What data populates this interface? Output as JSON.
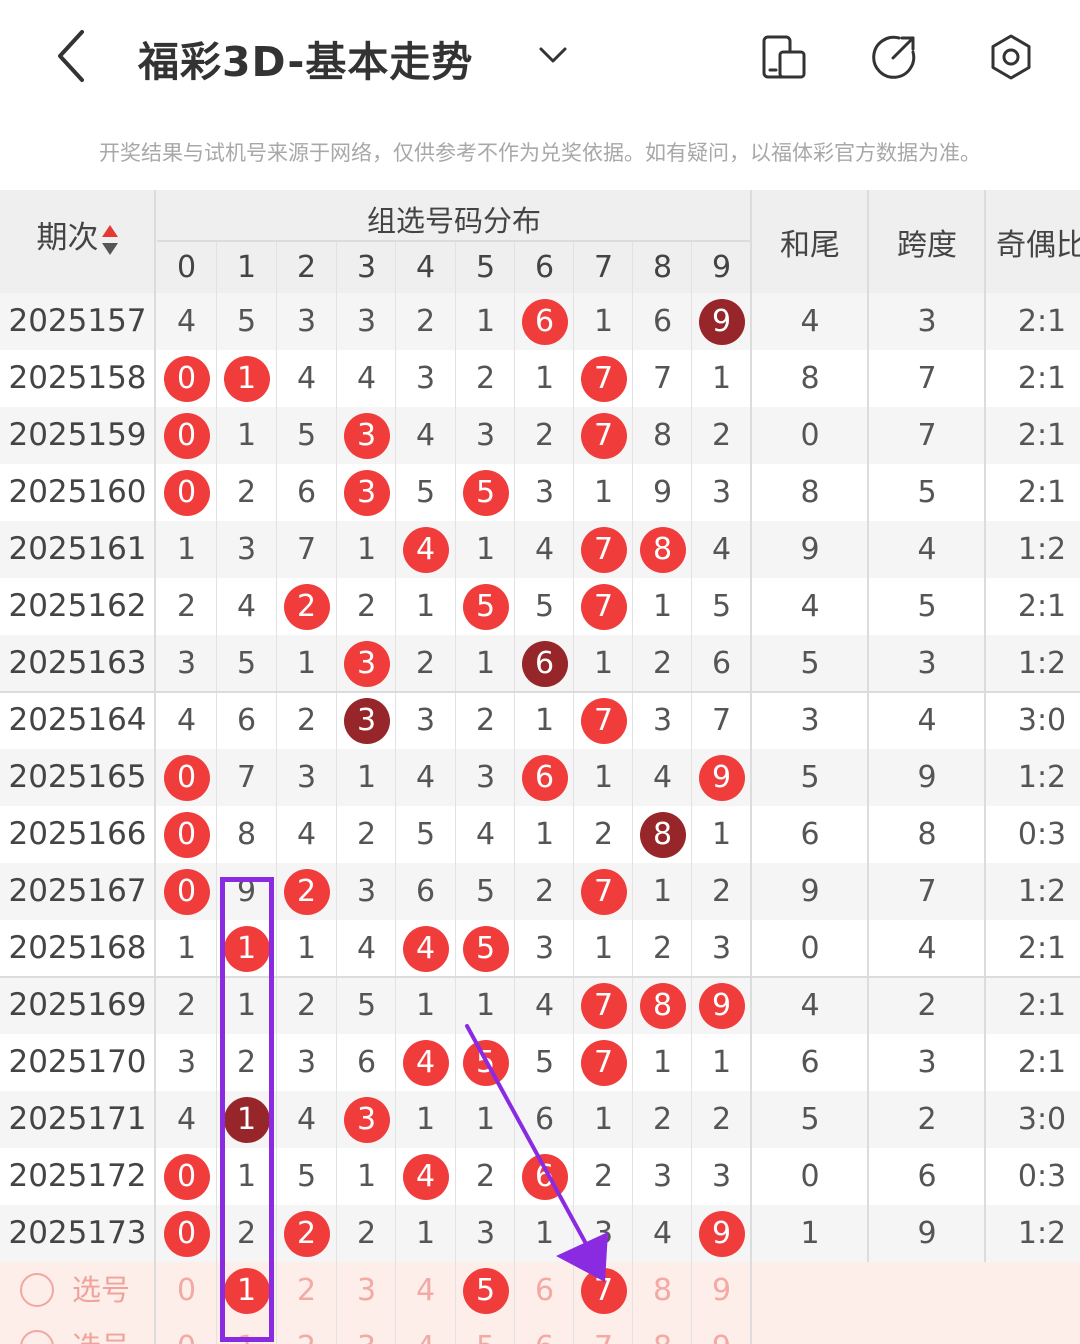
{
  "header": {
    "title": "福彩3D-基本走势",
    "icons": [
      "back-arrow-icon",
      "chevron-down-icon",
      "device-icon",
      "share-icon",
      "settings-hexagon-icon"
    ]
  },
  "notice": "开奖结果与试机号来源于网络，仅供参考不作为兑奖依据。如有疑问，以福体彩官方数据为准。",
  "table": {
    "col_issue": "期次",
    "group_title": "组选号码分布",
    "digits": [
      "0",
      "1",
      "2",
      "3",
      "4",
      "5",
      "6",
      "7",
      "8",
      "9"
    ],
    "col_hewei": "和尾",
    "col_kuadu": "跨度",
    "col_jiou": "奇偶比",
    "rows": [
      {
        "issue": "2025157",
        "cells": [
          [
            "4",
            0
          ],
          [
            "5",
            0
          ],
          [
            "3",
            0
          ],
          [
            "3",
            0
          ],
          [
            "2",
            0
          ],
          [
            "1",
            0
          ],
          [
            "6",
            1
          ],
          [
            "1",
            0
          ],
          [
            "6",
            0
          ],
          [
            "9",
            2
          ]
        ],
        "hewei": "4",
        "kuadu": "3",
        "jiou": "2:1"
      },
      {
        "issue": "2025158",
        "cells": [
          [
            "0",
            1
          ],
          [
            "1",
            1
          ],
          [
            "4",
            0
          ],
          [
            "4",
            0
          ],
          [
            "3",
            0
          ],
          [
            "2",
            0
          ],
          [
            "1",
            0
          ],
          [
            "7",
            1
          ],
          [
            "7",
            0
          ],
          [
            "1",
            0
          ]
        ],
        "hewei": "8",
        "kuadu": "7",
        "jiou": "2:1"
      },
      {
        "issue": "2025159",
        "cells": [
          [
            "0",
            1
          ],
          [
            "1",
            0
          ],
          [
            "5",
            0
          ],
          [
            "3",
            1
          ],
          [
            "4",
            0
          ],
          [
            "3",
            0
          ],
          [
            "2",
            0
          ],
          [
            "7",
            1
          ],
          [
            "8",
            0
          ],
          [
            "2",
            0
          ]
        ],
        "hewei": "0",
        "kuadu": "7",
        "jiou": "2:1"
      },
      {
        "issue": "2025160",
        "cells": [
          [
            "0",
            1
          ],
          [
            "2",
            0
          ],
          [
            "6",
            0
          ],
          [
            "3",
            1
          ],
          [
            "5",
            0
          ],
          [
            "5",
            1
          ],
          [
            "3",
            0
          ],
          [
            "1",
            0
          ],
          [
            "9",
            0
          ],
          [
            "3",
            0
          ]
        ],
        "hewei": "8",
        "kuadu": "5",
        "jiou": "2:1"
      },
      {
        "issue": "2025161",
        "cells": [
          [
            "1",
            0
          ],
          [
            "3",
            0
          ],
          [
            "7",
            0
          ],
          [
            "1",
            0
          ],
          [
            "4",
            1
          ],
          [
            "1",
            0
          ],
          [
            "4",
            0
          ],
          [
            "7",
            1
          ],
          [
            "8",
            1
          ],
          [
            "4",
            0
          ]
        ],
        "hewei": "9",
        "kuadu": "4",
        "jiou": "1:2"
      },
      {
        "issue": "2025162",
        "cells": [
          [
            "2",
            0
          ],
          [
            "4",
            0
          ],
          [
            "2",
            1
          ],
          [
            "2",
            0
          ],
          [
            "1",
            0
          ],
          [
            "5",
            1
          ],
          [
            "5",
            0
          ],
          [
            "7",
            1
          ],
          [
            "1",
            0
          ],
          [
            "5",
            0
          ]
        ],
        "hewei": "4",
        "kuadu": "5",
        "jiou": "2:1"
      },
      {
        "issue": "2025163",
        "cells": [
          [
            "3",
            0
          ],
          [
            "5",
            0
          ],
          [
            "1",
            0
          ],
          [
            "3",
            1
          ],
          [
            "2",
            0
          ],
          [
            "1",
            0
          ],
          [
            "6",
            2
          ],
          [
            "1",
            0
          ],
          [
            "2",
            0
          ],
          [
            "6",
            0
          ]
        ],
        "hewei": "5",
        "kuadu": "3",
        "jiou": "1:2"
      },
      {
        "issue": "2025164",
        "cells": [
          [
            "4",
            0
          ],
          [
            "6",
            0
          ],
          [
            "2",
            0
          ],
          [
            "3",
            2
          ],
          [
            "3",
            0
          ],
          [
            "2",
            0
          ],
          [
            "1",
            0
          ],
          [
            "7",
            1
          ],
          [
            "3",
            0
          ],
          [
            "7",
            0
          ]
        ],
        "hewei": "3",
        "kuadu": "4",
        "jiou": "3:0"
      },
      {
        "issue": "2025165",
        "cells": [
          [
            "0",
            1
          ],
          [
            "7",
            0
          ],
          [
            "3",
            0
          ],
          [
            "1",
            0
          ],
          [
            "4",
            0
          ],
          [
            "3",
            0
          ],
          [
            "6",
            1
          ],
          [
            "1",
            0
          ],
          [
            "4",
            0
          ],
          [
            "9",
            1
          ]
        ],
        "hewei": "5",
        "kuadu": "9",
        "jiou": "1:2"
      },
      {
        "issue": "2025166",
        "cells": [
          [
            "0",
            1
          ],
          [
            "8",
            0
          ],
          [
            "4",
            0
          ],
          [
            "2",
            0
          ],
          [
            "5",
            0
          ],
          [
            "4",
            0
          ],
          [
            "1",
            0
          ],
          [
            "2",
            0
          ],
          [
            "8",
            2
          ],
          [
            "1",
            0
          ]
        ],
        "hewei": "6",
        "kuadu": "8",
        "jiou": "0:3"
      },
      {
        "issue": "2025167",
        "cells": [
          [
            "0",
            1
          ],
          [
            "9",
            0
          ],
          [
            "2",
            1
          ],
          [
            "3",
            0
          ],
          [
            "6",
            0
          ],
          [
            "5",
            0
          ],
          [
            "2",
            0
          ],
          [
            "7",
            1
          ],
          [
            "1",
            0
          ],
          [
            "2",
            0
          ]
        ],
        "hewei": "9",
        "kuadu": "7",
        "jiou": "1:2"
      },
      {
        "issue": "2025168",
        "cells": [
          [
            "1",
            0
          ],
          [
            "1",
            1
          ],
          [
            "1",
            0
          ],
          [
            "4",
            0
          ],
          [
            "4",
            1
          ],
          [
            "5",
            1
          ],
          [
            "3",
            0
          ],
          [
            "1",
            0
          ],
          [
            "2",
            0
          ],
          [
            "3",
            0
          ]
        ],
        "hewei": "0",
        "kuadu": "4",
        "jiou": "2:1"
      },
      {
        "issue": "2025169",
        "cells": [
          [
            "2",
            0
          ],
          [
            "1",
            0
          ],
          [
            "2",
            0
          ],
          [
            "5",
            0
          ],
          [
            "1",
            0
          ],
          [
            "1",
            0
          ],
          [
            "4",
            0
          ],
          [
            "7",
            1
          ],
          [
            "8",
            1
          ],
          [
            "9",
            1
          ]
        ],
        "hewei": "4",
        "kuadu": "2",
        "jiou": "2:1"
      },
      {
        "issue": "2025170",
        "cells": [
          [
            "3",
            0
          ],
          [
            "2",
            0
          ],
          [
            "3",
            0
          ],
          [
            "6",
            0
          ],
          [
            "4",
            1
          ],
          [
            "5",
            1
          ],
          [
            "5",
            0
          ],
          [
            "7",
            1
          ],
          [
            "1",
            0
          ],
          [
            "1",
            0
          ]
        ],
        "hewei": "6",
        "kuadu": "3",
        "jiou": "2:1"
      },
      {
        "issue": "2025171",
        "cells": [
          [
            "4",
            0
          ],
          [
            "1",
            2
          ],
          [
            "4",
            0
          ],
          [
            "3",
            1
          ],
          [
            "1",
            0
          ],
          [
            "1",
            0
          ],
          [
            "6",
            0
          ],
          [
            "1",
            0
          ],
          [
            "2",
            0
          ],
          [
            "2",
            0
          ]
        ],
        "hewei": "5",
        "kuadu": "2",
        "jiou": "3:0"
      },
      {
        "issue": "2025172",
        "cells": [
          [
            "0",
            1
          ],
          [
            "1",
            0
          ],
          [
            "5",
            0
          ],
          [
            "1",
            0
          ],
          [
            "4",
            1
          ],
          [
            "2",
            0
          ],
          [
            "6",
            1
          ],
          [
            "2",
            0
          ],
          [
            "3",
            0
          ],
          [
            "3",
            0
          ]
        ],
        "hewei": "0",
        "kuadu": "6",
        "jiou": "0:3"
      },
      {
        "issue": "2025173",
        "cells": [
          [
            "0",
            1
          ],
          [
            "2",
            0
          ],
          [
            "2",
            1
          ],
          [
            "2",
            0
          ],
          [
            "1",
            0
          ],
          [
            "3",
            0
          ],
          [
            "1",
            0
          ],
          [
            "3",
            0
          ],
          [
            "4",
            0
          ],
          [
            "9",
            1
          ]
        ],
        "hewei": "1",
        "kuadu": "9",
        "jiou": "1:2"
      }
    ],
    "pick_rows": [
      {
        "label": "选号",
        "selected": [
          "1",
          "5",
          "7"
        ]
      },
      {
        "label": "选号",
        "selected": []
      }
    ]
  },
  "colors": {
    "ball_red": "#f13c3c",
    "ball_dark": "#96262a",
    "annotation_purple": "#8a2be2",
    "pick_bg": "#fdeeea"
  }
}
